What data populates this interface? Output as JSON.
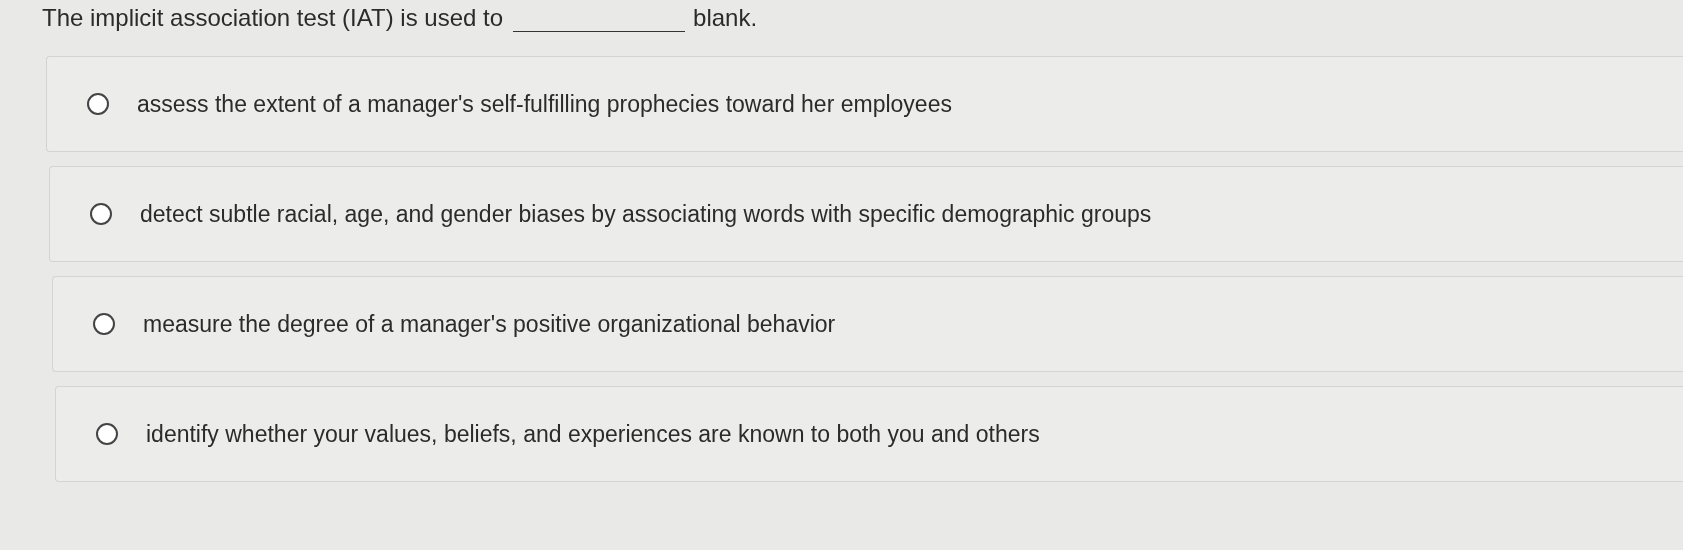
{
  "question": {
    "before": "The implicit association test (IAT) is used to",
    "after": "blank."
  },
  "options": [
    {
      "label": "assess the extent of a manager's self-fulfilling prophecies toward her employees",
      "selected": false
    },
    {
      "label": "detect subtle racial, age, and gender biases by associating words with specific demographic groups",
      "selected": false
    },
    {
      "label": "measure the degree of a manager's positive organizational behavior",
      "selected": false
    },
    {
      "label": "identify whether your values, beliefs, and experiences are known to both you and others",
      "selected": false
    }
  ]
}
